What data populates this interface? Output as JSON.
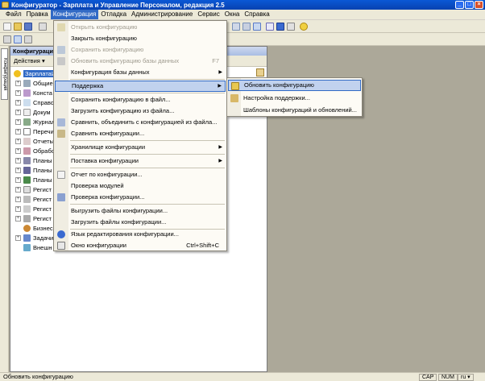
{
  "window": {
    "title": "Конфигуратор - Зарплата и Управление Персоналом, редакция 2.5",
    "minimize": "_",
    "maximize": "□",
    "close": "×"
  },
  "menubar": [
    "Файл",
    "Правка",
    "Конфигурация",
    "Отладка",
    "Администрирование",
    "Сервис",
    "Окна",
    "Справка"
  ],
  "config_panel": {
    "title": "Конфигурация",
    "side_tab": "Конфигурация",
    "actions_label": "Действия ▾",
    "root": "ЗарплатаИ",
    "tree": [
      "Общие",
      "Конста",
      "Справо",
      "Докум",
      "Журнал",
      "Перечи",
      "Отчеты",
      "Обрабо",
      "Планы",
      "Планы",
      "Планы",
      "Регист",
      "Регист",
      "Регист",
      "Регист",
      "Бизнес",
      "Задачи",
      "Внешн"
    ]
  },
  "menu": {
    "items": [
      {
        "label": "Открыть конфигурацию",
        "disabled": true,
        "icon": "open-config-icon"
      },
      {
        "label": "Закрыть конфигурацию",
        "icon": "close-config-icon"
      },
      {
        "label": "Сохранить конфигурацию",
        "disabled": true,
        "icon": "save-config-icon"
      },
      {
        "label": "Обновить конфигурацию базы данных",
        "disabled": true,
        "shortcut": "F7",
        "icon": "update-db-icon"
      },
      {
        "label": "Конфигурация базы данных",
        "submenu": true
      },
      {
        "label": "Поддержка",
        "submenu": true,
        "highlighted": true
      },
      {
        "label": "Сохранить конфигурацию в файл...",
        "icon": "save-file-icon"
      },
      {
        "label": "Загрузить конфигурацию из файла...",
        "icon": "load-file-icon"
      },
      {
        "label": "Сравнить, объединить с конфигурацией из файла...",
        "icon": "compare-merge-icon"
      },
      {
        "label": "Сравнить конфигурации...",
        "icon": "compare-icon"
      },
      {
        "label": "Хранилище конфигурации",
        "submenu": true
      },
      {
        "label": "Поставка конфигурации",
        "submenu": true
      },
      {
        "label": "Отчет по конфигурации...",
        "icon": "report-icon"
      },
      {
        "label": "Проверка модулей"
      },
      {
        "label": "Проверка конфигурации...",
        "icon": "check-icon"
      },
      {
        "label": "Выгрузить файлы конфигурации..."
      },
      {
        "label": "Загрузить файлы конфигурации..."
      },
      {
        "label": "Язык редактирования конфигурации...",
        "icon": "language-icon"
      },
      {
        "label": "Окно конфигурации",
        "shortcut": "Ctrl+Shift+C",
        "icon": "config-window-icon"
      }
    ]
  },
  "submenu": {
    "items": [
      {
        "label": "Обновить конфигурацию",
        "highlighted": true,
        "icon": "update-config-icon"
      },
      {
        "label": "Настройка поддержки...",
        "icon": "support-settings-icon"
      },
      {
        "label": "Шаблоны конфигураций и обновлений..."
      }
    ]
  },
  "status": {
    "text": "Обновить конфигурацию",
    "cap": "CAP",
    "num": "NUM",
    "lang": "ru ▾"
  }
}
